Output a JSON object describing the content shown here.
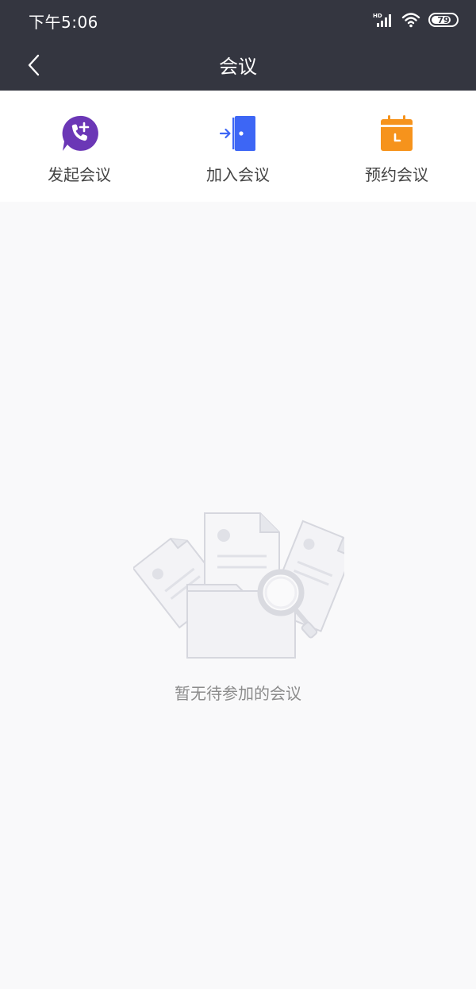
{
  "status_bar": {
    "time": "下午5:06",
    "network": "HD",
    "battery": "79",
    "battery_level": 0.79
  },
  "nav": {
    "title": "会议",
    "back_icon": "chevron-left-icon"
  },
  "actions": [
    {
      "label": "发起会议",
      "icon": "phone-plus-icon",
      "color": "#6b37b6"
    },
    {
      "label": "加入会议",
      "icon": "door-enter-icon",
      "color": "#3d66f5"
    },
    {
      "label": "预约会议",
      "icon": "calendar-clock-icon",
      "color": "#f6931c"
    }
  ],
  "empty_state": {
    "message": "暂无待参加的会议",
    "icon": "folder-documents-search-icon"
  },
  "colors": {
    "header_bg": "#343640",
    "page_bg": "#f9f9fa"
  }
}
